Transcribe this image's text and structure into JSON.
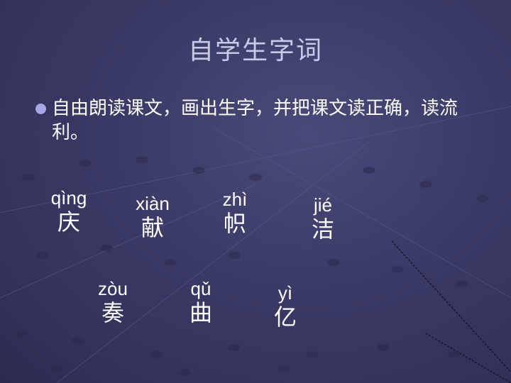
{
  "title": "自学生字词",
  "instruction": "自由朗读课文，画出生字，并把课文读正确，读流利。",
  "accent_color": "#a8a8e6",
  "words": [
    {
      "pinyin": "qìng",
      "hanzi": "庆"
    },
    {
      "pinyin": "xiàn",
      "hanzi": "献"
    },
    {
      "pinyin": "zhì",
      "hanzi": "帜"
    },
    {
      "pinyin": "jié",
      "hanzi": "洁"
    },
    {
      "pinyin": "zòu",
      "hanzi": "奏"
    },
    {
      "pinyin": "qǔ",
      "hanzi": "曲"
    },
    {
      "pinyin": "yì",
      "hanzi": "亿"
    }
  ]
}
